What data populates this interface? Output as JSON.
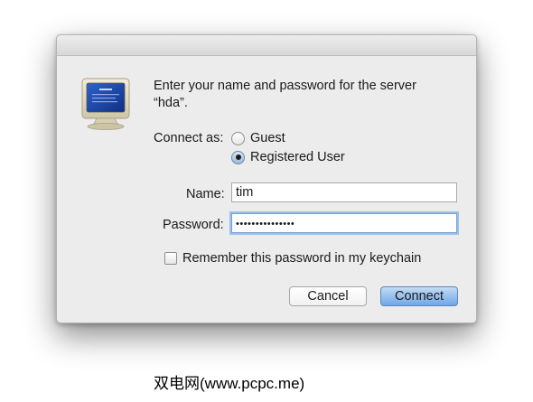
{
  "dialog": {
    "prompt_line1": "Enter your name and password for the server",
    "prompt_line2": "“hda”.",
    "icon": "server-monitor-icon",
    "connect_as": {
      "label": "Connect as:",
      "options": [
        {
          "label": "Guest",
          "selected": false
        },
        {
          "label": "Registered User",
          "selected": true
        }
      ]
    },
    "name": {
      "label": "Name:",
      "value": "tim"
    },
    "password": {
      "label": "Password:",
      "value_masked": "•••••••••••••••"
    },
    "remember": {
      "label": "Remember this password in my keychain",
      "checked": false
    },
    "buttons": {
      "cancel": "Cancel",
      "connect": "Connect"
    },
    "colors": {
      "default_button": "#6fa6e6",
      "focus_ring": "#9cc0ee"
    }
  },
  "watermark": "双电网(www.pcpc.me)"
}
